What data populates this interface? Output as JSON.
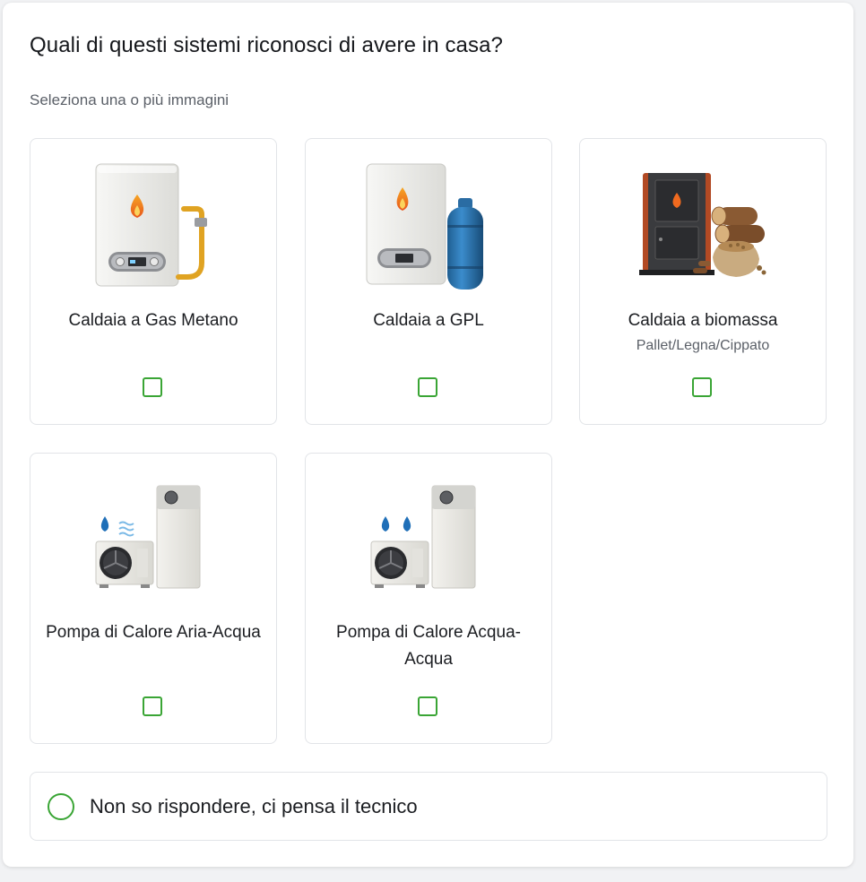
{
  "question": {
    "title": "Quali di questi sistemi riconosci di avere in casa?",
    "hint": "Seleziona una o più immagini"
  },
  "options": [
    {
      "label": "Caldaia a Gas Metano",
      "sublabel": "",
      "icon": "gas-boiler-icon",
      "checked": false
    },
    {
      "label": "Caldaia a GPL",
      "sublabel": "",
      "icon": "lpg-boiler-icon",
      "checked": false
    },
    {
      "label": "Caldaia a biomassa",
      "sublabel": "Pallet/Legna/Cippato",
      "icon": "biomass-boiler-icon",
      "checked": false
    },
    {
      "label": "Pompa di Calore Aria-Acqua",
      "sublabel": "",
      "icon": "air-water-heat-pump-icon",
      "checked": false
    },
    {
      "label": "Pompa di Calore Acqua-Acqua",
      "sublabel": "",
      "icon": "water-water-heat-pump-icon",
      "checked": false
    }
  ],
  "fallback": {
    "label": "Non so rispondere, ci pensa il tecnico",
    "selected": false
  },
  "colors": {
    "accent": "#3aa535",
    "border": "#e2e4e8",
    "text": "#1b1d21",
    "muted": "#5b6068"
  }
}
